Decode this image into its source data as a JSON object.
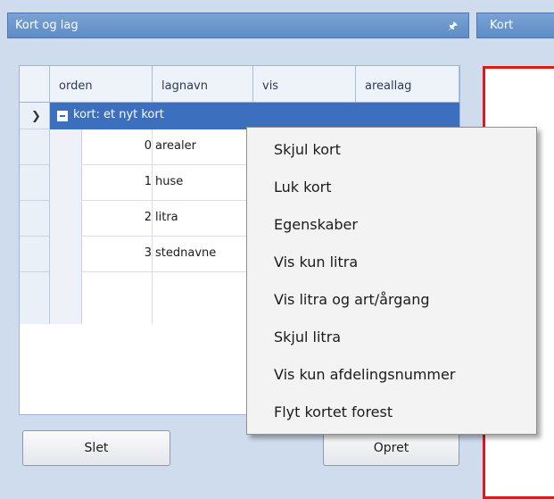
{
  "left_panel": {
    "title": "Kort og lag",
    "pin_icon": "pin-icon",
    "grid": {
      "headers": [
        "orden",
        "lagnavn",
        "vis",
        "areallag"
      ],
      "group_row": {
        "label": "kort: et nyt kort"
      },
      "rows": [
        {
          "orden": "0",
          "lagnavn": "arealer"
        },
        {
          "orden": "1",
          "lagnavn": "huse"
        },
        {
          "orden": "2",
          "lagnavn": "litra"
        },
        {
          "orden": "3",
          "lagnavn": "stednavne"
        }
      ]
    },
    "buttons": {
      "delete": "Slet",
      "create": "Opret"
    }
  },
  "right_panel": {
    "title": "Kort"
  },
  "context_menu": {
    "items": [
      "Skjul kort",
      "Luk kort",
      "Egenskaber",
      "Vis kun litra",
      "Vis litra og art/årgang",
      "Skjul litra",
      "Vis kun afdelingsnummer",
      "Flyt kortet forest"
    ]
  },
  "colors": {
    "title_bar": "#6f97cd",
    "selection": "#3c6fbd",
    "map_border": "#e01818"
  }
}
